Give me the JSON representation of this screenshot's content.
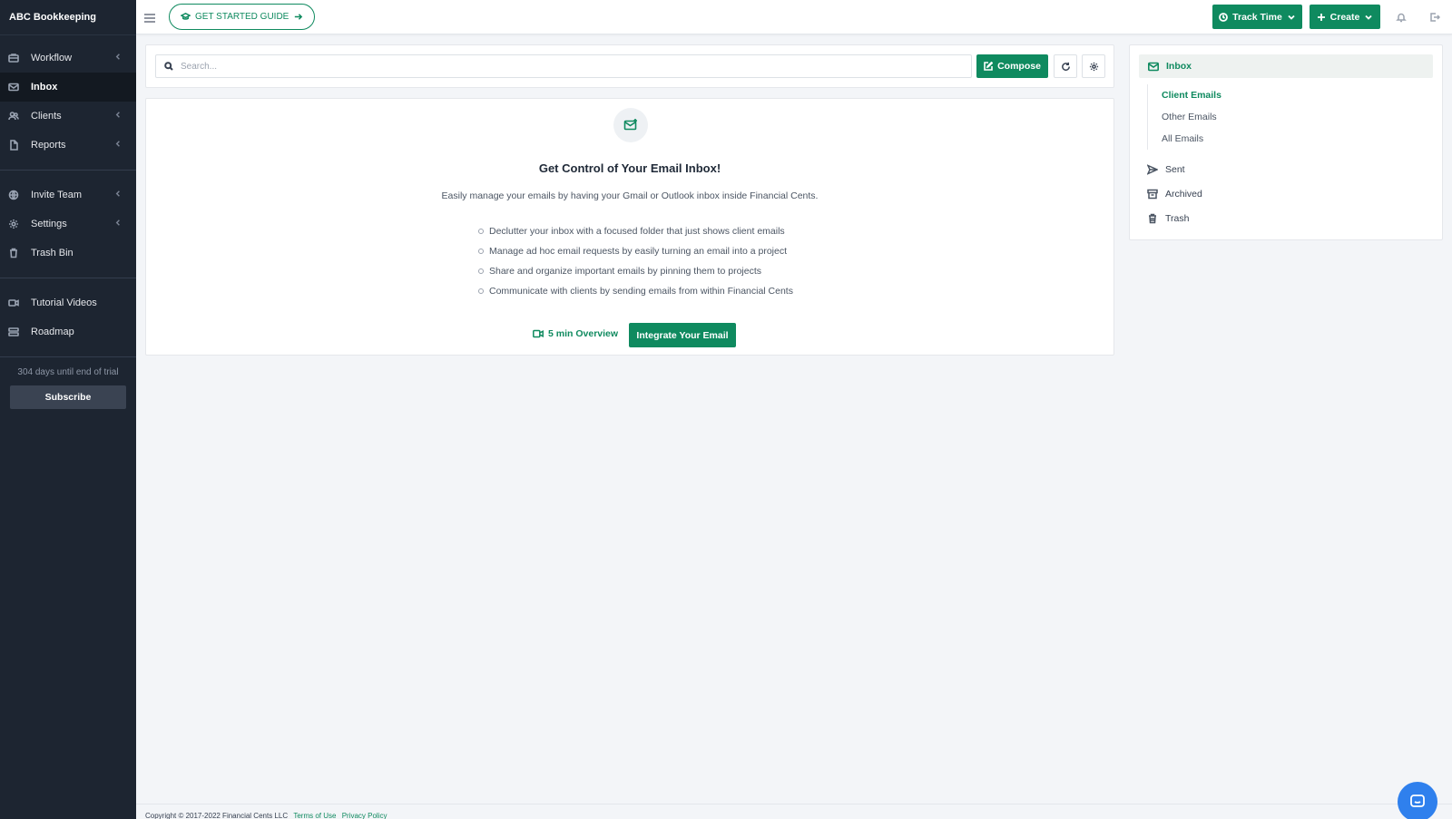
{
  "app": {
    "brand": "ABC Bookkeeping"
  },
  "sidebar": {
    "items": [
      {
        "label": "Workflow",
        "icon": "briefcase-icon",
        "has_chevron": true,
        "active": false
      },
      {
        "label": "Inbox",
        "icon": "mail-icon",
        "has_chevron": false,
        "active": true
      },
      {
        "label": "Clients",
        "icon": "users-icon",
        "has_chevron": true,
        "active": false
      },
      {
        "label": "Reports",
        "icon": "document-icon",
        "has_chevron": true,
        "active": false
      },
      {
        "label": "Invite Team",
        "icon": "globe-icon",
        "has_chevron": true,
        "active": false
      },
      {
        "label": "Settings",
        "icon": "gear-icon",
        "has_chevron": true,
        "active": false
      },
      {
        "label": "Trash Bin",
        "icon": "trash-icon",
        "has_chevron": false,
        "active": false
      },
      {
        "label": "Tutorial Videos",
        "icon": "video-icon",
        "has_chevron": false,
        "active": false
      },
      {
        "label": "Roadmap",
        "icon": "roadmap-icon",
        "has_chevron": false,
        "active": false
      }
    ],
    "trial_text": "304 days until end of trial",
    "subscribe_label": "Subscribe"
  },
  "topbar": {
    "guide_label": "GET STARTED GUIDE",
    "track_time_label": "Track Time",
    "create_label": "Create"
  },
  "toolbar": {
    "search_placeholder": "Search...",
    "compose_label": "Compose"
  },
  "hero": {
    "title": "Get Control of Your Email Inbox!",
    "subtitle": "Easily manage your emails by having your Gmail or Outlook inbox inside Financial Cents.",
    "features": [
      "Declutter your inbox with a focused folder that just shows client emails",
      "Manage ad hoc email requests by easily turning an email into a project",
      "Share and organize important emails by pinning them to projects",
      "Communicate with clients by sending emails from within Financial Cents"
    ],
    "overview_label": "5 min Overview",
    "integrate_label": "Integrate Your Email"
  },
  "folders": {
    "inbox_label": "Inbox",
    "sub_items": [
      "Client Emails",
      "Other Emails",
      "All Emails"
    ],
    "sent_label": "Sent",
    "archived_label": "Archived",
    "trash_label": "Trash"
  },
  "footer": {
    "copyright": "Copyright © 2017-2022 Financial Cents LLC",
    "terms_label": "Terms of Use",
    "privacy_label": "Privacy Policy"
  },
  "colors": {
    "accent": "#0f8a5f",
    "sidebar_bg": "#1d2531",
    "chat": "#2f80ed"
  }
}
